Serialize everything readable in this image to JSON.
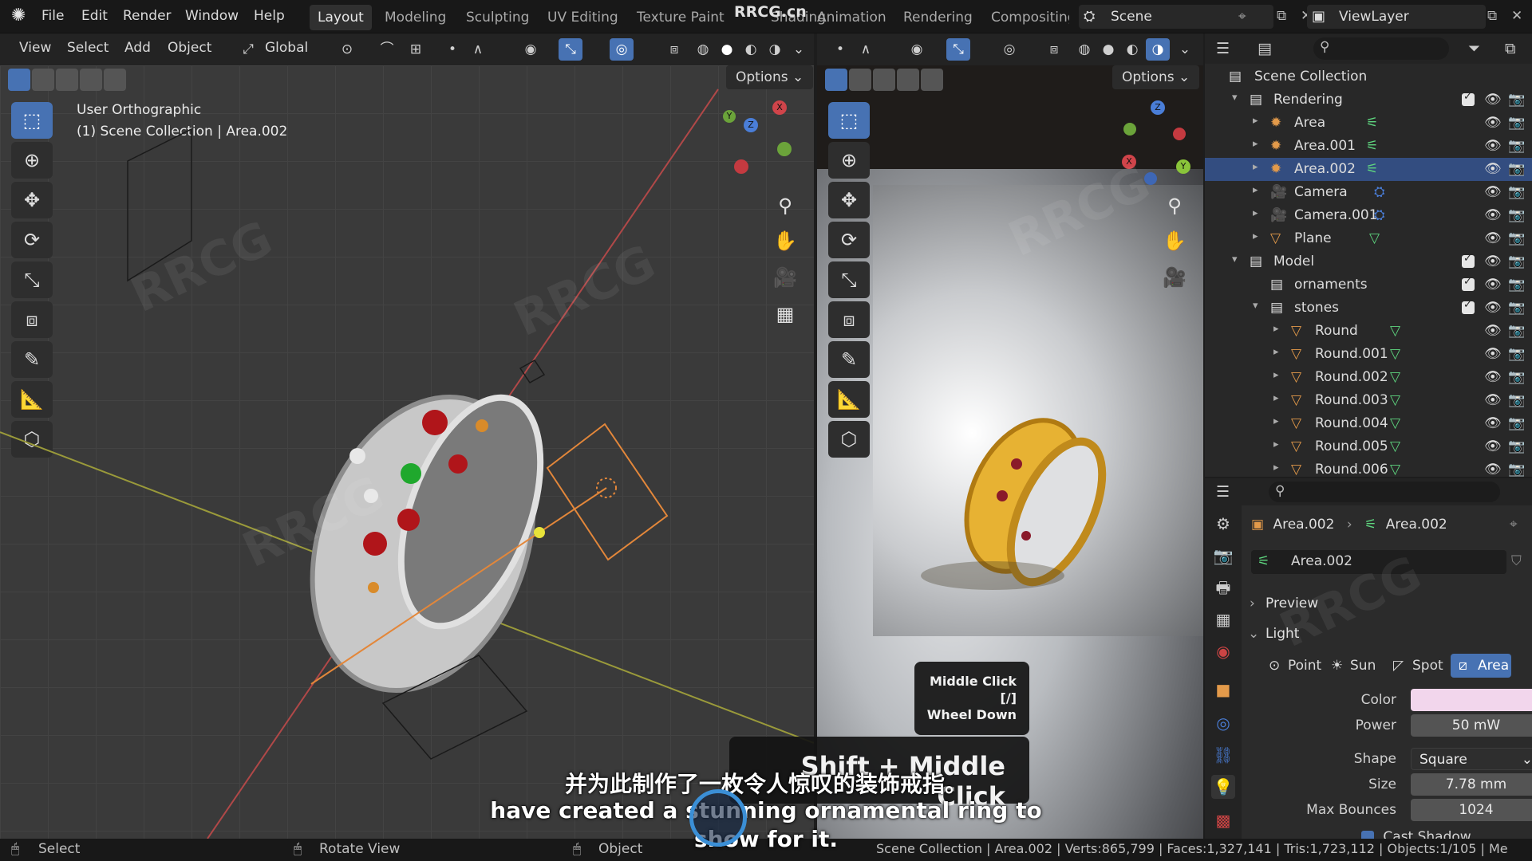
{
  "menu": {
    "file": "File",
    "edit": "Edit",
    "render": "Render",
    "window": "Window",
    "help": "Help"
  },
  "workspaces": [
    "Layout",
    "Modeling",
    "Sculpting",
    "UV Editing",
    "Texture Paint",
    "Shading",
    "Animation",
    "Rendering",
    "Compositing"
  ],
  "active_workspace": "Layout",
  "brand_watermark": "RRCG.cn",
  "scene": {
    "name": "Scene",
    "view_layer": "ViewLayer"
  },
  "viewport_left": {
    "menus": {
      "view": "View",
      "select": "Select",
      "add": "Add",
      "object": "Object"
    },
    "orientation": "Global",
    "options": "Options",
    "info_line1": "User Orthographic",
    "info_line2": "(1) Scene Collection | Area.002"
  },
  "viewport_right": {
    "options": "Options"
  },
  "outliner": {
    "root": "Scene Collection",
    "rows": [
      {
        "label": "Rendering",
        "kind": "collection"
      },
      {
        "label": "Area",
        "kind": "light"
      },
      {
        "label": "Area.001",
        "kind": "light"
      },
      {
        "label": "Area.002",
        "kind": "light",
        "selected": true
      },
      {
        "label": "Camera",
        "kind": "camera"
      },
      {
        "label": "Camera.001",
        "kind": "camera"
      },
      {
        "label": "Plane",
        "kind": "mesh"
      },
      {
        "label": "Model",
        "kind": "collection"
      },
      {
        "label": "ornaments",
        "kind": "collection"
      },
      {
        "label": "stones",
        "kind": "collection"
      },
      {
        "label": "Round",
        "kind": "mesh"
      },
      {
        "label": "Round.001",
        "kind": "mesh"
      },
      {
        "label": "Round.002",
        "kind": "mesh"
      },
      {
        "label": "Round.003",
        "kind": "mesh"
      },
      {
        "label": "Round.004",
        "kind": "mesh"
      },
      {
        "label": "Round.005",
        "kind": "mesh"
      },
      {
        "label": "Round.006",
        "kind": "mesh"
      }
    ]
  },
  "properties": {
    "breadcrumb_object": "Area.002",
    "breadcrumb_data": "Area.002",
    "datablock": "Area.002",
    "panel_preview": "Preview",
    "panel_light": "Light",
    "light_types": [
      "Point",
      "Sun",
      "Spot",
      "Area"
    ],
    "active_light_type": "Area",
    "color_label": "Color",
    "color_value": "#f2d6ec",
    "power_label": "Power",
    "power_value": "50 mW",
    "shape_label": "Shape",
    "shape_value": "Square",
    "size_label": "Size",
    "size_value": "7.78 mm",
    "max_bounces_label": "Max Bounces",
    "max_bounces_value": "1024",
    "cast_shadow_label": "Cast Shadow"
  },
  "keycast": {
    "line1": "Middle Click",
    "line2": "[/]",
    "line3": "Wheel Down",
    "combo": "Shift + Middle Click"
  },
  "subtitles": {
    "chinese": "并为此制作了一枚令人惊叹的装饰戒指。",
    "english_line1": "have created a stunning ornamental ring to",
    "english_line2": "show for it."
  },
  "statusbar": {
    "select": "Select",
    "rotate_view": "Rotate View",
    "object": "Object",
    "stats": "Scene Collection | Area.002 | Verts:865,799 | Faces:1,327,141 | Tris:1,723,112 | Objects:1/105 | Me"
  },
  "colors": {
    "accent": "#4772b3",
    "selected_row": "#334d80",
    "light_icon": "#e39a4a",
    "mesh_icon": "#e39a4a",
    "vertex_group_icon": "#5ed67f"
  }
}
